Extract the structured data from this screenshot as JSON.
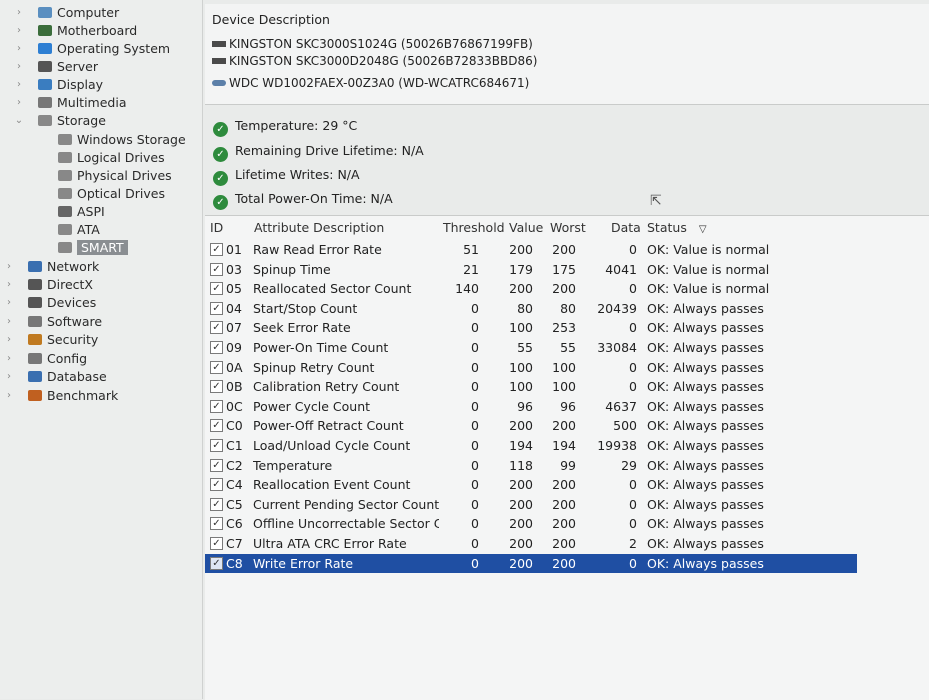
{
  "tree": {
    "items": [
      {
        "label": "Computer",
        "arrow": "›",
        "icon": "computer-icon",
        "color": "#5a8fc0"
      },
      {
        "label": "Motherboard",
        "arrow": "›",
        "icon": "motherboard-icon",
        "color": "#3b6d3b"
      },
      {
        "label": "Operating System",
        "arrow": "›",
        "icon": "windows-icon",
        "color": "#2d7fd3"
      },
      {
        "label": "Server",
        "arrow": "›",
        "icon": "server-icon",
        "color": "#555"
      },
      {
        "label": "Display",
        "arrow": "›",
        "icon": "display-icon",
        "color": "#3a7dc0"
      },
      {
        "label": "Multimedia",
        "arrow": "›",
        "icon": "multimedia-icon",
        "color": "#777"
      },
      {
        "label": "Storage",
        "arrow": "⌄",
        "icon": "storage-icon",
        "color": "#888"
      },
      {
        "label": "Windows Storage",
        "arrow": "",
        "icon": "windows-storage-icon",
        "color": "#888"
      },
      {
        "label": "Logical Drives",
        "arrow": "",
        "icon": "logical-drives-icon",
        "color": "#888"
      },
      {
        "label": "Physical Drives",
        "arrow": "",
        "icon": "physical-drives-icon",
        "color": "#888"
      },
      {
        "label": "Optical Drives",
        "arrow": "",
        "icon": "optical-drives-icon",
        "color": "#888"
      },
      {
        "label": "ASPI",
        "arrow": "",
        "icon": "aspi-icon",
        "color": "#666"
      },
      {
        "label": "ATA",
        "arrow": "",
        "icon": "ata-icon",
        "color": "#888"
      },
      {
        "label": "SMART",
        "arrow": "",
        "icon": "smart-icon",
        "color": "#888"
      },
      {
        "label": "Network",
        "arrow": "›",
        "icon": "network-icon",
        "color": "#3a6fb0"
      },
      {
        "label": "DirectX",
        "arrow": "›",
        "icon": "directx-icon",
        "color": "#555"
      },
      {
        "label": "Devices",
        "arrow": "›",
        "icon": "devices-icon",
        "color": "#555"
      },
      {
        "label": "Software",
        "arrow": "›",
        "icon": "software-icon",
        "color": "#777"
      },
      {
        "label": "Security",
        "arrow": "›",
        "icon": "security-icon",
        "color": "#c07a20"
      },
      {
        "label": "Config",
        "arrow": "›",
        "icon": "config-icon",
        "color": "#777"
      },
      {
        "label": "Database",
        "arrow": "›",
        "icon": "database-icon",
        "color": "#3a6fb0"
      },
      {
        "label": "Benchmark",
        "arrow": "›",
        "icon": "benchmark-icon",
        "color": "#c06020"
      }
    ]
  },
  "devices": {
    "header": "Device Description",
    "list": [
      {
        "label": "KINGSTON SKC3000S1024G (50026B76867199FB)",
        "icon": "ssd-icon"
      },
      {
        "label": "KINGSTON SKC3000D2048G (50026B72833BBD86)",
        "icon": "ssd-icon"
      },
      {
        "label": "WDC WD1002FAEX-00Z3A0 (WD-WCATRC684671)",
        "icon": "hdd-icon"
      }
    ]
  },
  "status": [
    "Temperature: 29 °C",
    "Remaining Drive Lifetime: N/A",
    "Lifetime Writes: N/A",
    "Total Power-On Time: N/A"
  ],
  "table": {
    "headers": {
      "id": "ID",
      "desc": "Attribute Description",
      "threshold": "Threshold",
      "value": "Value",
      "worst": "Worst",
      "data": "Data",
      "status": "Status"
    },
    "sort_icon": "▽",
    "check": "✓",
    "rows": [
      {
        "id": "01",
        "desc": "Raw Read Error Rate",
        "threshold": "51",
        "value": "200",
        "worst": "200",
        "data": "0",
        "status": "OK: Value is normal"
      },
      {
        "id": "03",
        "desc": "Spinup Time",
        "threshold": "21",
        "value": "179",
        "worst": "175",
        "data": "4041",
        "status": "OK: Value is normal"
      },
      {
        "id": "05",
        "desc": "Reallocated Sector Count",
        "threshold": "140",
        "value": "200",
        "worst": "200",
        "data": "0",
        "status": "OK: Value is normal"
      },
      {
        "id": "04",
        "desc": "Start/Stop Count",
        "threshold": "0",
        "value": "80",
        "worst": "80",
        "data": "20439",
        "status": "OK: Always passes"
      },
      {
        "id": "07",
        "desc": "Seek Error Rate",
        "threshold": "0",
        "value": "100",
        "worst": "253",
        "data": "0",
        "status": "OK: Always passes"
      },
      {
        "id": "09",
        "desc": "Power-On Time Count",
        "threshold": "0",
        "value": "55",
        "worst": "55",
        "data": "33084",
        "status": "OK: Always passes"
      },
      {
        "id": "0A",
        "desc": "Spinup Retry Count",
        "threshold": "0",
        "value": "100",
        "worst": "100",
        "data": "0",
        "status": "OK: Always passes"
      },
      {
        "id": "0B",
        "desc": "Calibration Retry Count",
        "threshold": "0",
        "value": "100",
        "worst": "100",
        "data": "0",
        "status": "OK: Always passes"
      },
      {
        "id": "0C",
        "desc": "Power Cycle Count",
        "threshold": "0",
        "value": "96",
        "worst": "96",
        "data": "4637",
        "status": "OK: Always passes"
      },
      {
        "id": "C0",
        "desc": "Power-Off Retract Count",
        "threshold": "0",
        "value": "200",
        "worst": "200",
        "data": "500",
        "status": "OK: Always passes"
      },
      {
        "id": "C1",
        "desc": "Load/Unload Cycle Count",
        "threshold": "0",
        "value": "194",
        "worst": "194",
        "data": "19938",
        "status": "OK: Always passes"
      },
      {
        "id": "C2",
        "desc": "Temperature",
        "threshold": "0",
        "value": "118",
        "worst": "99",
        "data": "29",
        "status": "OK: Always passes"
      },
      {
        "id": "C4",
        "desc": "Reallocation Event Count",
        "threshold": "0",
        "value": "200",
        "worst": "200",
        "data": "0",
        "status": "OK: Always passes"
      },
      {
        "id": "C5",
        "desc": "Current Pending Sector Count",
        "threshold": "0",
        "value": "200",
        "worst": "200",
        "data": "0",
        "status": "OK: Always passes"
      },
      {
        "id": "C6",
        "desc": "Offline Uncorrectable Sector Co...",
        "threshold": "0",
        "value": "200",
        "worst": "200",
        "data": "0",
        "status": "OK: Always passes"
      },
      {
        "id": "C7",
        "desc": "Ultra ATA CRC Error Rate",
        "threshold": "0",
        "value": "200",
        "worst": "200",
        "data": "2",
        "status": "OK: Always passes"
      },
      {
        "id": "C8",
        "desc": "Write Error Rate",
        "threshold": "0",
        "value": "200",
        "worst": "200",
        "data": "0",
        "status": "OK: Always passes"
      }
    ],
    "selected_row": "C8"
  },
  "colors": {
    "selection": "#1f4fa3",
    "ok": "#2e8b3d"
  }
}
